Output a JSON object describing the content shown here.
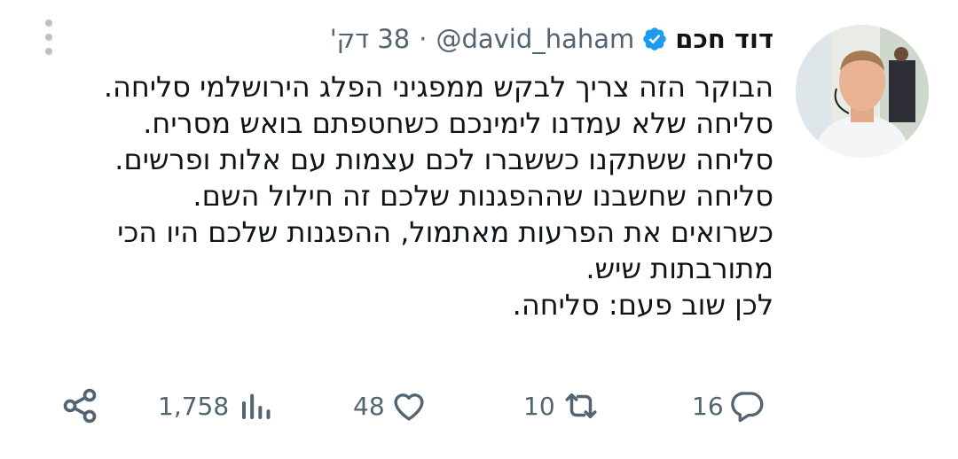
{
  "author": {
    "name": "דוד חכם",
    "handle": "@david_haham",
    "separator": "·",
    "time": "38 דק'",
    "verified_icon": "verified-badge-icon",
    "verified_color": "#1d9bf0"
  },
  "tweet": {
    "lines": [
      "הבוקר הזה צריך לבקש ממפגיני הפלג הירושלמי סליחה.",
      "סליחה שלא עמדנו לימינכם כשחטפתם בואש מסריח.",
      "סליחה ששתקנו כששברו לכם עצמות עם אלות ופרשים.",
      "סליחה שחשבנו שההפגנות שלכם זה חילול השם.",
      "כשרואים את הפרעות מאתמול, ההפגנות שלכם היו הכי",
      "מתורבתות שיש.",
      "לכן שוב פעם: סליחה."
    ]
  },
  "actions": {
    "replies": "16",
    "retweets": "10",
    "likes": "48",
    "views": "1,758"
  },
  "icons": {
    "reply": "reply-icon",
    "retweet": "retweet-icon",
    "like": "heart-icon",
    "views": "views-chart-icon",
    "share": "share-icon",
    "more": "more-options-icon"
  },
  "colors": {
    "text": "#0f1419",
    "secondary": "#536471",
    "accent": "#1d9bf0"
  }
}
